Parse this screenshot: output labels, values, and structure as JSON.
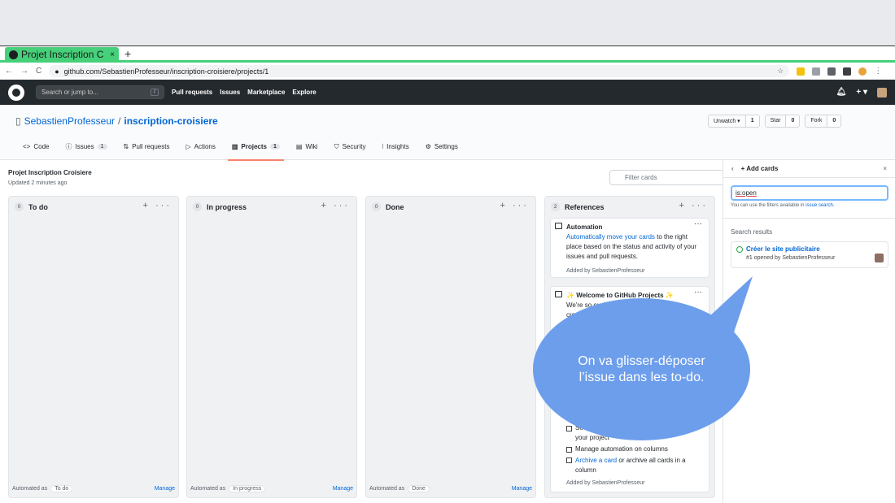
{
  "browser": {
    "tab_title": "Projet Inscription C",
    "tab_close": "×",
    "new_tab": "+",
    "url": "github.com/SebastienProfesseur/inscription-croisiere/projects/1",
    "nav_back": "←",
    "nav_forward": "→",
    "nav_reload": "C",
    "star": "☆",
    "menu": "⋮"
  },
  "github": {
    "search_placeholder": "Search or jump to...",
    "search_key": "/",
    "nav": [
      "Pull requests",
      "Issues",
      "Marketplace",
      "Explore"
    ],
    "plus": "+ ▾"
  },
  "repo": {
    "owner": "SebastienProfesseur",
    "sep": "/",
    "name": "inscription-croisiere",
    "unwatch": "Unwatch ▾",
    "unwatch_count": "1",
    "star": "Star",
    "star_count": "0",
    "fork": "Fork",
    "fork_count": "0",
    "tabs": [
      {
        "icon": "<>",
        "label": "Code",
        "count": ""
      },
      {
        "icon": "ⓘ",
        "label": "Issues",
        "count": "1"
      },
      {
        "icon": "⇅",
        "label": "Pull requests",
        "count": ""
      },
      {
        "icon": "▷",
        "label": "Actions",
        "count": ""
      },
      {
        "icon": "▥",
        "label": "Projects",
        "count": "1"
      },
      {
        "icon": "▤",
        "label": "Wiki",
        "count": ""
      },
      {
        "icon": "⛉",
        "label": "Security",
        "count": ""
      },
      {
        "icon": "⦚",
        "label": "Insights",
        "count": ""
      },
      {
        "icon": "⚙",
        "label": "Settings",
        "count": ""
      }
    ]
  },
  "project": {
    "title": "Projet Inscription Croisiere",
    "updated": "Updated 2 minutes ago",
    "filter_placeholder": "Filter cards",
    "columns": [
      {
        "count": "0",
        "name": "To do",
        "automated": "Automated as",
        "tag": "To do",
        "manage": "Manage"
      },
      {
        "count": "0",
        "name": "In progress",
        "automated": "Automated as",
        "tag": "In progress",
        "manage": "Manage"
      },
      {
        "count": "0",
        "name": "Done",
        "automated": "Automated as",
        "tag": "Done",
        "manage": "Manage"
      },
      {
        "count": "2",
        "name": "References",
        "automated": "",
        "tag": "",
        "manage": ""
      }
    ],
    "col_add": "+",
    "col_more": "···",
    "card1": {
      "title": "Automation",
      "link": "Automatically move your cards",
      "text": " to the right place based on the status and activity of your issues and pull requests.",
      "by": "Added by SebastienProfesseur"
    },
    "card2": {
      "title": "Welcome to GitHub Projects",
      "line1": "We're so excit",
      "line1b": "to",
      "line2": "cre",
      "task1": "Se",
      "task1b": "your project",
      "task2": "Manage automation on columns",
      "task3_link": "Archive a card",
      "task3_text": " or archive all cards in a column",
      "by": "Added by SebastienProfesseur"
    }
  },
  "panel": {
    "back": "‹",
    "title": "+ Add cards",
    "close": "×",
    "query": "is:open",
    "hint_text": "You can use the filters available in ",
    "hint_link": "issue search.",
    "results_label": "Search results",
    "result_title": "Créer le site publicitaire",
    "result_sub": "#1 opened by SebastienProfesseur"
  },
  "annotation": {
    "text": "On va glisser-déposer l’issue dans les to-do.",
    "color": "#6d9eeb"
  }
}
